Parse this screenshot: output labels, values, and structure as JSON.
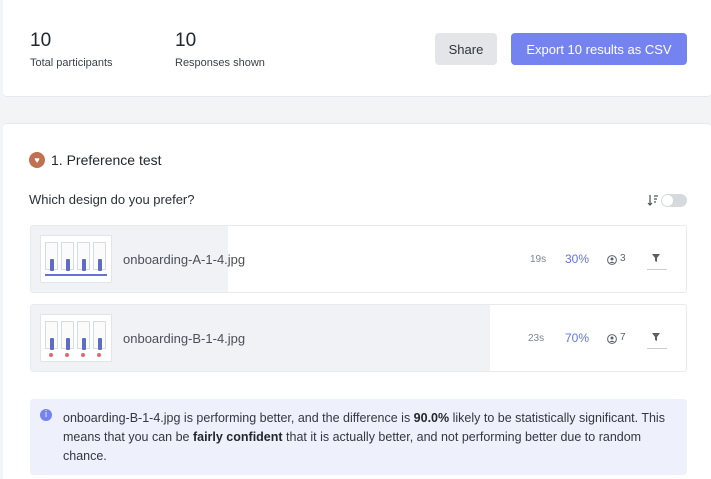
{
  "summary": {
    "total_participants": "10",
    "total_participants_label": "Total participants",
    "responses_shown": "10",
    "responses_shown_label": "Responses shown",
    "share_label": "Share",
    "export_label": "Export 10 results as CSV"
  },
  "section": {
    "title": "1. Preference test",
    "icon": "heart-icon",
    "question": "Which design do you prefer?",
    "sort_icon": "sort-descending-icon",
    "toggle_on": false
  },
  "options": [
    {
      "filename": "onboarding-A-1-4.jpg",
      "time": "19s",
      "percent": "30%",
      "share": 0.3,
      "count": "3"
    },
    {
      "filename": "onboarding-B-1-4.jpg",
      "time": "23s",
      "percent": "70%",
      "share": 0.7,
      "count": "7"
    }
  ],
  "info": {
    "part1": "onboarding-B-1-4.jpg is performing better, and the difference is ",
    "bold1": "90.0%",
    "part2": " likely to be statistically significant. This means that you can be ",
    "bold2": "fairly confident",
    "part3": " that it is actually better, and not performing better due to random chance."
  },
  "colors": {
    "accent": "#7483f0",
    "percent": "#6474e0",
    "heart": "#c0714f",
    "info_bg": "#eef1fb"
  }
}
